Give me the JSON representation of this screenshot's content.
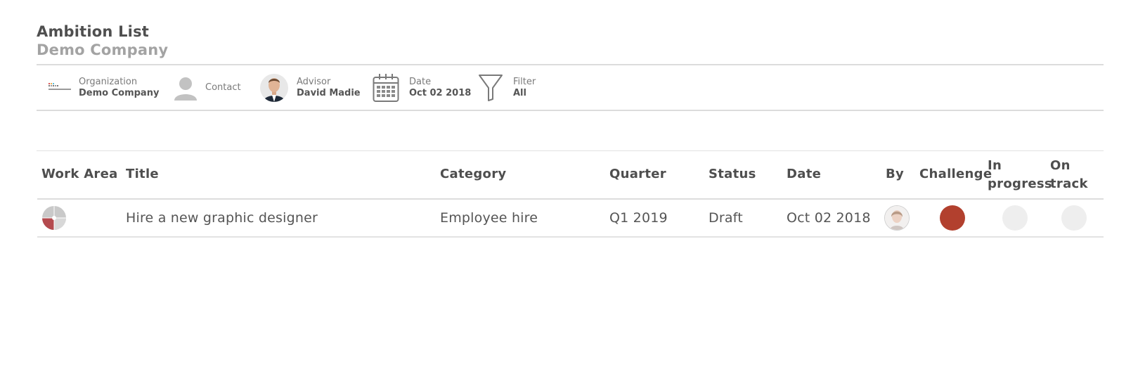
{
  "header": {
    "title": "Ambition List",
    "subtitle": "Demo Company"
  },
  "infobar": {
    "organization": {
      "label": "Organization",
      "value": "Demo Company",
      "icon": "company-logo-icon"
    },
    "contact": {
      "label": "Contact",
      "icon": "person-silhouette-icon"
    },
    "advisor": {
      "label": "Advisor",
      "value": "David Madie",
      "icon": "advisor-avatar"
    },
    "date": {
      "label": "Date",
      "value": "Oct 02 2018",
      "icon": "calendar-icon"
    },
    "filter": {
      "label": "Filter",
      "value": "All",
      "icon": "funnel-icon"
    }
  },
  "table": {
    "columns": {
      "work_area": "Work Area",
      "title": "Title",
      "category": "Category",
      "quarter": "Quarter",
      "status": "Status",
      "date": "Date",
      "by": "By",
      "challenge": "Challenge",
      "in_progress_1": "In",
      "in_progress_2": "progress",
      "on_track_1": "On",
      "on_track_2": "track"
    },
    "rows": [
      {
        "work_area_icon": "work-area-pie-icon",
        "title": "Hire a new graphic designer",
        "category": "Employee hire",
        "quarter": "Q1 2019",
        "status": "Draft",
        "date": "Oct 02 2018",
        "by_icon": "user-avatar",
        "challenge": true,
        "in_progress": false,
        "on_track": false
      }
    ]
  },
  "colors": {
    "challenge_active": "#b2402e",
    "indicator_inactive": "#eeeeee",
    "work_area_red": "#b44a4e",
    "work_area_gray": "#c9c9c9"
  }
}
